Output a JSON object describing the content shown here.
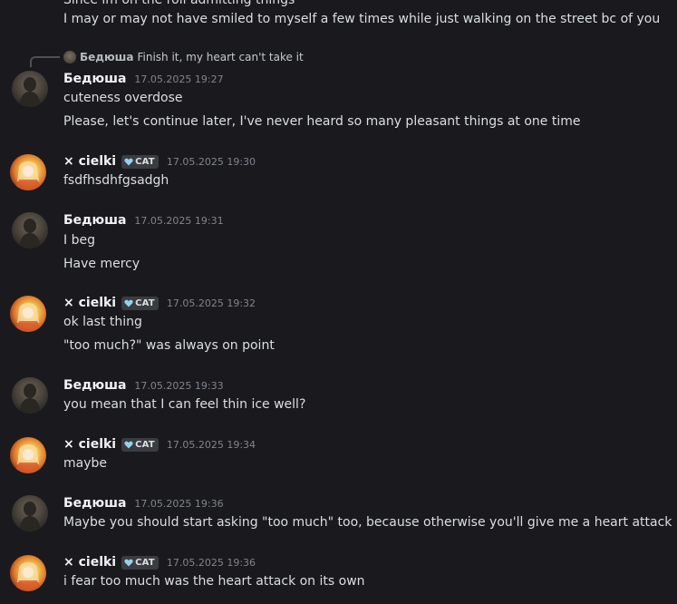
{
  "messages": {
    "m0": {
      "text_1": "I may or may not have smiled to myself a few times while just walking on the street bc of you"
    },
    "m1": {
      "reply": {
        "name": "Бедюша",
        "text": "Finish it, my heart can't take it"
      },
      "author": "Бедюша",
      "timestamp": "17.05.2025 19:27",
      "text_1": "cuteness overdose",
      "text_2": "Please, let's continue later, I've never heard so many pleasant things at one time"
    },
    "m2": {
      "author": "× cielki",
      "tag": "CAT",
      "timestamp": "17.05.2025 19:30",
      "text_1": "fsdfhsdhfgsadgh"
    },
    "m3": {
      "author": "Бедюша",
      "timestamp": "17.05.2025 19:31",
      "text_1": "I beg",
      "text_2": "Have mercy"
    },
    "m4": {
      "author": "× cielki",
      "tag": "CAT",
      "timestamp": "17.05.2025 19:32",
      "text_1": "ok last thing",
      "text_2": "\"too much?\" was always on point"
    },
    "m5": {
      "author": "Бедюша",
      "timestamp": "17.05.2025 19:33",
      "text_1": "you mean that I can feel thin ice well?"
    },
    "m6": {
      "author": "× cielki",
      "tag": "CAT",
      "timestamp": "17.05.2025 19:34",
      "text_1": "maybe"
    },
    "m7": {
      "author": "Бедюша",
      "timestamp": "17.05.2025 19:36",
      "text_1": "Maybe you should start asking \"too much\" too, because otherwise you'll give me a heart attack"
    },
    "m8": {
      "author": "× cielki",
      "tag": "CAT",
      "timestamp": "17.05.2025 19:36",
      "text_1": "i fear too much was the heart attack on its own"
    }
  },
  "colors": {
    "background": "#1a1a1e",
    "text": "#dbdee1",
    "username": "#f2f3f5",
    "timestamp": "#80848e",
    "tag_background": "#3a3c42",
    "tag_heart": "#8fd3f4"
  },
  "icons": {
    "tag": "heart-icon",
    "avatar_a": "person-silhouette-avatar",
    "avatar_b": "anime-character-avatar"
  }
}
